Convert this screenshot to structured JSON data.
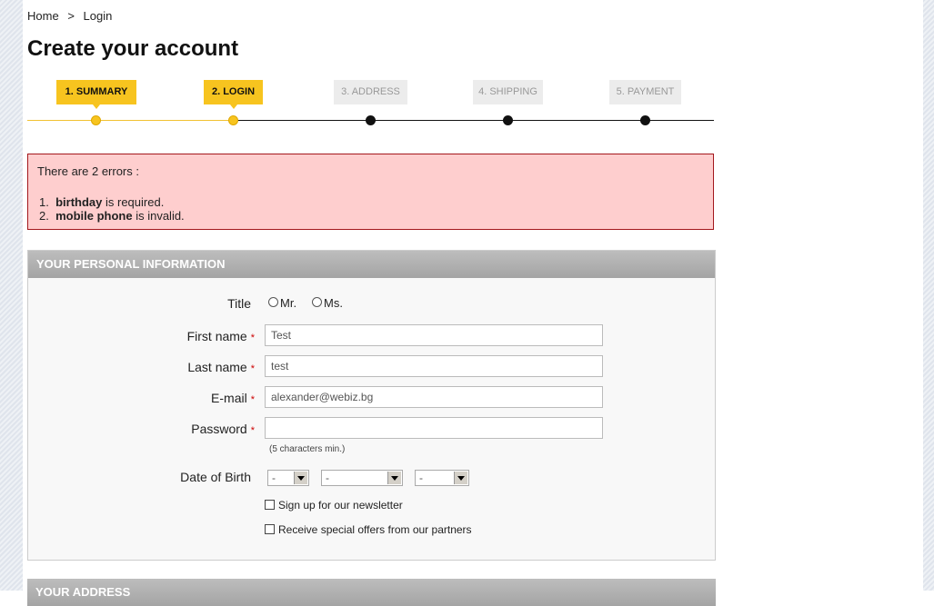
{
  "breadcrumb": {
    "home": "Home",
    "separator": ">",
    "current": "Login"
  },
  "page_title": "Create your account",
  "steps": [
    {
      "label": "1. SUMMARY",
      "state": "done"
    },
    {
      "label": "2. LOGIN",
      "state": "done"
    },
    {
      "label": "3. ADDRESS",
      "state": "todo"
    },
    {
      "label": "4. SHIPPING",
      "state": "todo"
    },
    {
      "label": "5. PAYMENT",
      "state": "todo"
    }
  ],
  "errors": {
    "title": "There are 2 errors :",
    "items": [
      {
        "num": "1.",
        "field": "birthday",
        "msg": "is required."
      },
      {
        "num": "2.",
        "field": "mobile phone",
        "msg": "is invalid."
      }
    ]
  },
  "personal_info": {
    "header": "YOUR PERSONAL INFORMATION",
    "title_label": "Title",
    "title_options": [
      "Mr.",
      "Ms."
    ],
    "first_name_label": "First name",
    "first_name_value": "Test",
    "last_name_label": "Last name",
    "last_name_value": "test",
    "email_label": "E-mail",
    "email_value": "alexander@webiz.bg",
    "password_label": "Password",
    "password_value": "",
    "password_hint": "(5 characters min.)",
    "dob_label": "Date of Birth",
    "dob_day": "-",
    "dob_month": "-",
    "dob_year": "-",
    "newsletter_label": "Sign up for our newsletter",
    "optin_label": "Receive special offers from our partners",
    "required_mark": "*"
  },
  "address": {
    "header": "YOUR ADDRESS"
  },
  "colors": {
    "step_done": "#f7c41f",
    "error_bg": "#fecece",
    "error_border": "#a3171c"
  }
}
